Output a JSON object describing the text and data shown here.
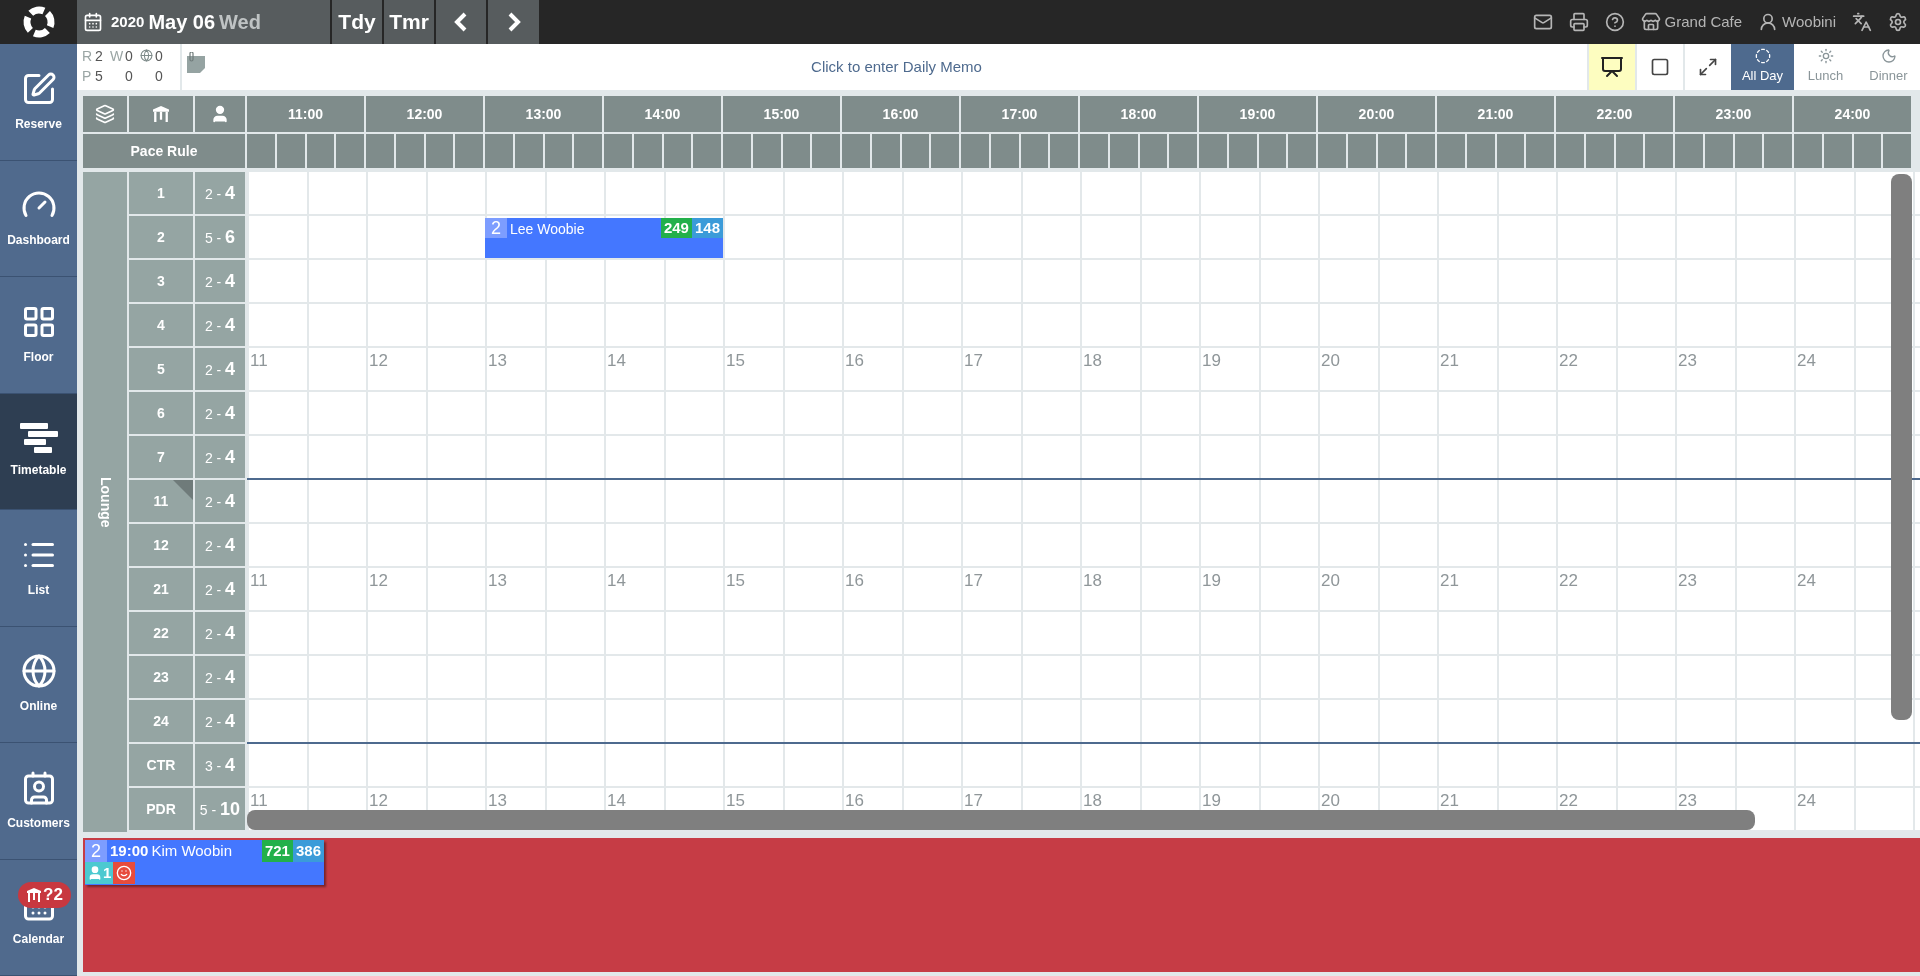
{
  "topbar": {
    "date": {
      "year": "2020",
      "month_day": "May 06",
      "weekday": "Wed"
    },
    "quick_days": [
      "Tdy",
      "Tmr"
    ],
    "tools": [
      {
        "kind": "mail"
      },
      {
        "kind": "print"
      },
      {
        "kind": "help"
      },
      {
        "kind": "store",
        "label": "Grand Cafe"
      },
      {
        "kind": "user",
        "label": "Woobini"
      },
      {
        "kind": "language"
      },
      {
        "kind": "settings"
      }
    ]
  },
  "sidebar": {
    "items": [
      {
        "kind": "reserve",
        "label": "Reserve",
        "selected": false
      },
      {
        "kind": "dashboard",
        "label": "Dashboard",
        "selected": false
      },
      {
        "kind": "floor",
        "label": "Floor",
        "selected": false
      },
      {
        "kind": "timetable",
        "label": "Timetable",
        "selected": true
      },
      {
        "kind": "list",
        "label": "List",
        "selected": false
      },
      {
        "kind": "online",
        "label": "Online",
        "selected": false
      },
      {
        "kind": "customers",
        "label": "Customers",
        "selected": false
      },
      {
        "kind": "calendar",
        "label": "Calendar",
        "selected": false,
        "badge": "?2"
      }
    ]
  },
  "summary": {
    "rows": [
      {
        "label": "R",
        "cells": [
          {
            "kind": "count",
            "text": "2"
          },
          {
            "kind": "label",
            "text": "W"
          },
          {
            "kind": "count",
            "text": "0"
          },
          {
            "kind": "globe"
          },
          {
            "kind": "count",
            "text": "0"
          }
        ]
      },
      {
        "label": "P",
        "cells": [
          {
            "kind": "count",
            "text": "5"
          },
          {
            "kind": "gap"
          },
          {
            "kind": "count",
            "text": "0"
          },
          {
            "kind": "gap"
          },
          {
            "kind": "count",
            "text": "0"
          }
        ]
      }
    ]
  },
  "memo": {
    "placeholder": "Click to enter Daily Memo"
  },
  "view_tools": [
    {
      "kind": "presentation",
      "active": true
    },
    {
      "kind": "checkbox",
      "active": false
    },
    {
      "kind": "expand",
      "active": false
    }
  ],
  "meal_tabs": [
    {
      "kind": "all_day",
      "label": "All Day",
      "selected": true
    },
    {
      "kind": "lunch",
      "label": "Lunch",
      "selected": false
    },
    {
      "kind": "dinner",
      "label": "Dinner",
      "selected": false
    }
  ],
  "timetable": {
    "hours": [
      "11:00",
      "12:00",
      "13:00",
      "14:00",
      "15:00",
      "16:00",
      "17:00",
      "18:00",
      "19:00",
      "20:00",
      "21:00",
      "22:00",
      "23:00",
      "24:00"
    ],
    "pace_rule_label": "Pace Rule",
    "area": "Lounge",
    "tables": [
      {
        "name": "1",
        "pax": "2 - **4**",
        "flagged": false,
        "section_end": false
      },
      {
        "name": "2",
        "pax": "5 - **6**",
        "flagged": false,
        "section_end": false,
        "bookings": [
          {
            "party": "2",
            "name": "Lee Woobie",
            "score": "249",
            "visits": "148",
            "occupied": [
              false,
              false,
              true,
              true,
              false,
              false,
              false,
              false,
              false,
              false,
              false,
              false,
              false,
              false
            ]
          }
        ]
      },
      {
        "name": "3",
        "pax": "2 - **4**",
        "flagged": false,
        "section_end": false
      },
      {
        "name": "4",
        "pax": "2 - **4**",
        "flagged": false,
        "section_end": false
      },
      {
        "name": "5",
        "pax": "2 - **4**",
        "flagged": false,
        "section_end": false,
        "hour_marks": [
          "11",
          "12",
          "13",
          "14",
          "15",
          "16",
          "17",
          "18",
          "19",
          "20",
          "21",
          "22",
          "23",
          "24"
        ]
      },
      {
        "name": "6",
        "pax": "2 - **4**",
        "flagged": false,
        "section_end": false
      },
      {
        "name": "7",
        "pax": "2 - **4**",
        "flagged": false,
        "section_end": true
      },
      {
        "name": "11",
        "pax": "2 - **4**",
        "flagged": true,
        "section_end": false
      },
      {
        "name": "12",
        "pax": "2 - **4**",
        "flagged": false,
        "section_end": false
      },
      {
        "name": "21",
        "pax": "2 - **4**",
        "flagged": false,
        "section_end": false,
        "hour_marks": [
          "11",
          "12",
          "13",
          "14",
          "15",
          "16",
          "17",
          "18",
          "19",
          "20",
          "21",
          "22",
          "23",
          "24"
        ]
      },
      {
        "name": "22",
        "pax": "2 - **4**",
        "flagged": false,
        "section_end": false
      },
      {
        "name": "23",
        "pax": "2 - **4**",
        "flagged": false,
        "section_end": false
      },
      {
        "name": "24",
        "pax": "2 - **4**",
        "flagged": false,
        "section_end": true
      },
      {
        "name": "CTR",
        "pax": "3 - **4**",
        "flagged": false,
        "section_end": false
      },
      {
        "name": "PDR",
        "pax": "5 - **10**",
        "flagged": false,
        "section_end": false,
        "hour_marks": [
          "11",
          "12",
          "13",
          "14",
          "15",
          "16",
          "17",
          "18",
          "19",
          "20",
          "21",
          "22",
          "23",
          "24"
        ]
      }
    ]
  },
  "unassigned": [
    {
      "party": "2",
      "time": "19:00",
      "name": "Kim Woobin",
      "score": "721",
      "visits": "386",
      "guests": "1"
    }
  ]
}
